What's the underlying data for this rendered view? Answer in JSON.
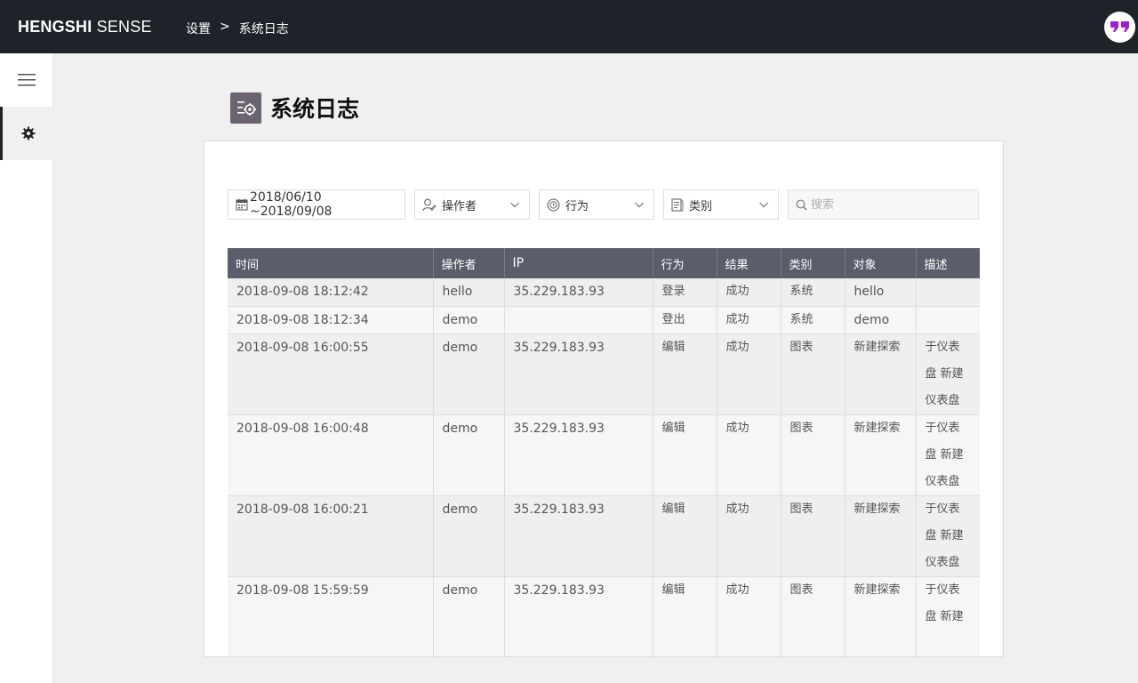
{
  "brand": {
    "bold": "HENGSHI",
    "light": "SENSE"
  },
  "breadcrumb": {
    "parent": "设置",
    "separator": ">",
    "current": "系统日志"
  },
  "page": {
    "title": "系统日志"
  },
  "filters": {
    "date_range": "2018/06/10 ~2018/09/08",
    "operator_label": "操作者",
    "action_label": "行为",
    "category_label": "类别",
    "search_placeholder": "搜索"
  },
  "table": {
    "headers": [
      "时间",
      "操作者",
      "IP",
      "行为",
      "结果",
      "类别",
      "对象",
      "描述"
    ],
    "rows": [
      [
        "2018-09-08 18:12:42",
        "hello",
        "35.229.183.93",
        "登录",
        "成功",
        "系统",
        "hello",
        ""
      ],
      [
        "2018-09-08 18:12:34",
        "demo",
        "",
        "登出",
        "成功",
        "系统",
        "demo",
        ""
      ],
      [
        "2018-09-08 16:00:55",
        "demo",
        "35.229.183.93",
        "编辑",
        "成功",
        "图表",
        "新建探索",
        "于仪表盘 新建仪表盘"
      ],
      [
        "2018-09-08 16:00:48",
        "demo",
        "35.229.183.93",
        "编辑",
        "成功",
        "图表",
        "新建探索",
        "于仪表盘 新建仪表盘"
      ],
      [
        "2018-09-08 16:00:21",
        "demo",
        "35.229.183.93",
        "编辑",
        "成功",
        "图表",
        "新建探索",
        "于仪表盘 新建仪表盘"
      ],
      [
        "2018-09-08 15:59:59",
        "demo",
        "35.229.183.93",
        "编辑",
        "成功",
        "图表",
        "新建探索",
        "于仪表盘 新建"
      ]
    ]
  },
  "colors": {
    "topbar": "#1e2229",
    "table_header": "#5b5e6a",
    "avatar_accent": "#a020c8",
    "page_icon": "#6b6470"
  }
}
